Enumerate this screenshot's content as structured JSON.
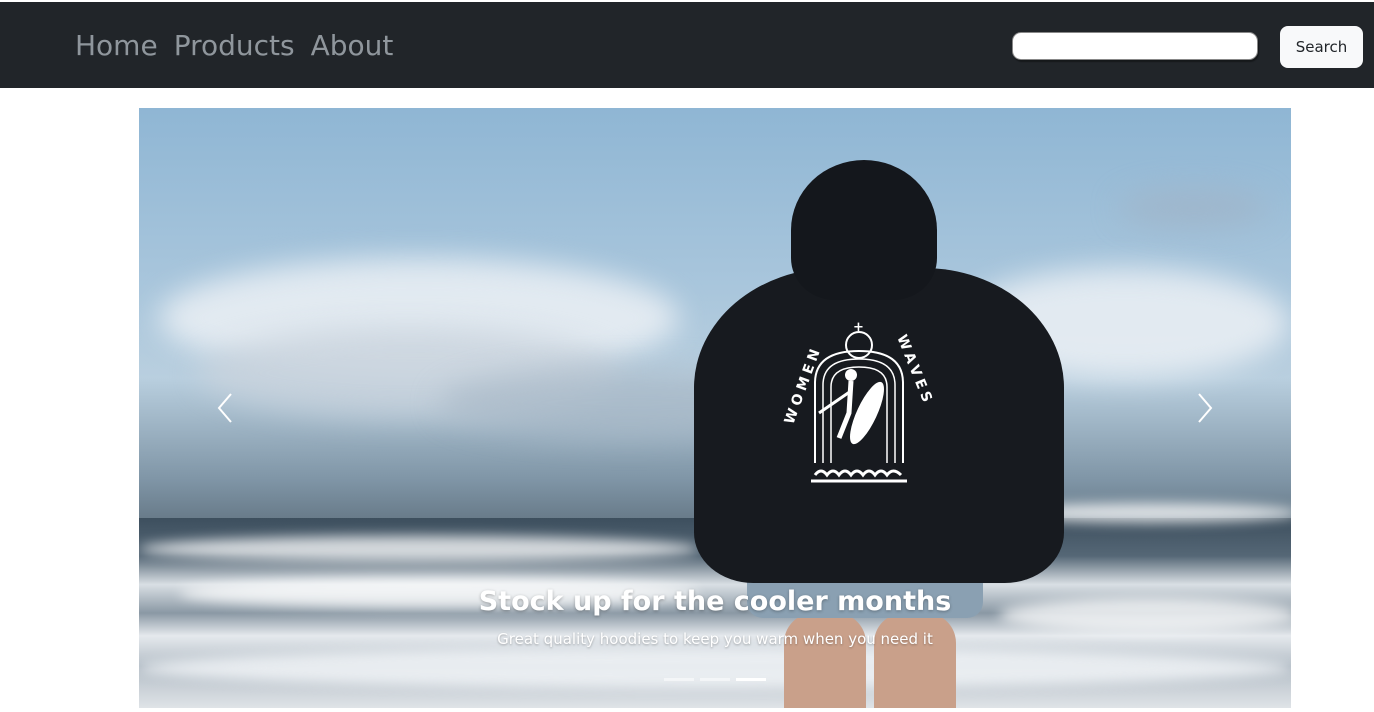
{
  "nav": {
    "links": [
      {
        "label": "Home"
      },
      {
        "label": "Products"
      },
      {
        "label": "About"
      }
    ],
    "search": {
      "value": "",
      "placeholder": "",
      "button_label": "Search"
    }
  },
  "carousel": {
    "active_slide": 3,
    "slide_count": 3,
    "image": {
      "logo_text_left": "WOMEN",
      "logo_text_plus": "+",
      "logo_text_right": "WAVES"
    },
    "caption": {
      "title": "Stock up for the cooler months",
      "text": "Great quality hoodies to keep you warm when you need it"
    },
    "controls": {
      "prev_icon": "chevron-left-icon",
      "next_icon": "chevron-right-icon"
    }
  },
  "colors": {
    "navbar_bg": "#212529",
    "nav_link": "#8f969c",
    "button_bg": "#f8f9fa",
    "caption_text": "#ffffff"
  }
}
